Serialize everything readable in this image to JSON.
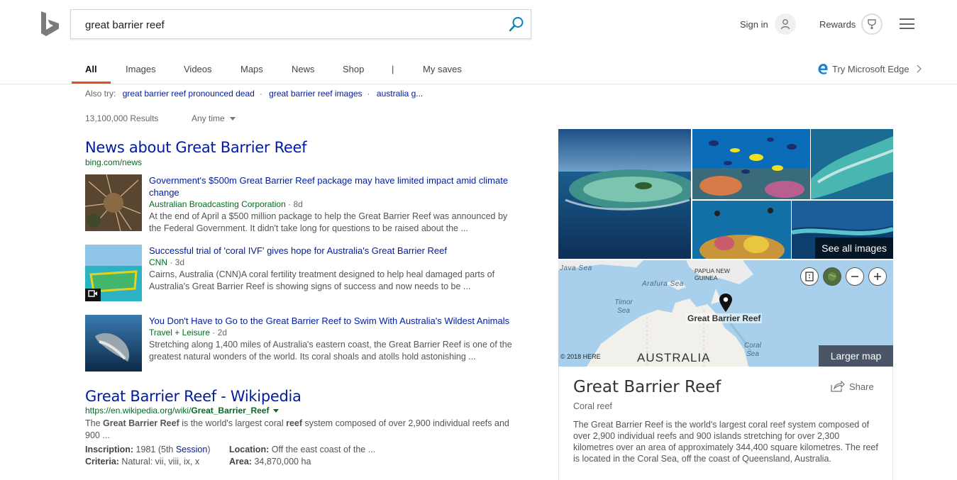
{
  "header": {
    "search_query": "great barrier reef",
    "sign_in_label": "Sign in",
    "rewards_label": "Rewards"
  },
  "tabs": [
    {
      "label": "All",
      "active": true
    },
    {
      "label": "Images"
    },
    {
      "label": "Videos"
    },
    {
      "label": "Maps"
    },
    {
      "label": "News"
    },
    {
      "label": "Shop"
    },
    {
      "label": "|"
    },
    {
      "label": "My saves"
    }
  ],
  "edge_promo": "Try Microsoft Edge",
  "also_try": {
    "label": "Also try:",
    "links": [
      "great barrier reef pronounced dead",
      "great barrier reef images",
      "australia g..."
    ]
  },
  "results_count": "13,100,000 Results",
  "time_filter": "Any time",
  "news": {
    "title": "News about Great Barrier Reef",
    "url": "bing.com/news",
    "items": [
      {
        "headline": "Government's $500m Great Barrier Reef package may have limited impact amid climate change",
        "source": "Australian Broadcasting Corporation",
        "age": "8d",
        "snippet": "At the end of April a $500 million package to help the Great Barrier Reef was announced by the Federal Government. It didn't take long for questions to be raised about the ..."
      },
      {
        "headline": "Successful trial of 'coral IVF' gives hope for Australia's Great Barrier Reef",
        "source": "CNN",
        "age": "3d",
        "snippet": "Cairns, Australia (CNN)A coral fertility treatment designed to help heal damaged parts of Australia's Great Barrier Reef is showing signs of success and now needs to be ..."
      },
      {
        "headline": "You Don't Have to Go to the Great Barrier Reef to Swim With Australia's Wildest Animals",
        "source": "Travel + Leisure",
        "age": "2d",
        "snippet": "Stretching along 1,400 miles of Australia's eastern coast, the Great Barrier Reef is one of the greatest natural wonders of the world. Its coral shoals and atolls hold astonishing ..."
      }
    ]
  },
  "wiki": {
    "title": "Great Barrier Reef - Wikipedia",
    "url_prefix": "https://en.wikipedia.org/wiki/",
    "url_bold": "Great_Barrier_Reef",
    "snippet_parts": [
      "The ",
      "Great Barrier Reef",
      " is the world's largest coral ",
      "reef",
      " system composed of over 2,900 individual reefs and 900 ..."
    ],
    "facts": [
      {
        "label": "Inscription:",
        "value": "1981 (5th ",
        "value_link": "Session",
        "value_end": ")"
      },
      {
        "label": "Location:",
        "value": "Off the east coast of the ..."
      },
      {
        "label": "Criteria:",
        "value": "Natural: vii, viii, ix, x"
      },
      {
        "label": "Area:",
        "value": "34,870,000 ha"
      }
    ]
  },
  "images_panel": {
    "see_all_label": "See all images"
  },
  "map": {
    "labels": {
      "java_sea": "Java Sea",
      "papua": "PAPUA NEW GUINEA",
      "arafura": "Arafura Sea",
      "timor": "Timor Sea",
      "pin": "Great Barrier Reef",
      "coral": "Coral Sea",
      "australia": "AUSTRALIA",
      "copyright": "© 2018 HERE"
    },
    "larger_map_label": "Larger map"
  },
  "entity": {
    "title": "Great Barrier Reef",
    "subtitle": "Coral reef",
    "share_label": "Share",
    "description": "The Great Barrier Reef is the world's largest coral reef system composed of over 2,900 individual reefs and 900 islands stretching for over 2,300 kilometres over an area of approximately 344,400 square kilometres. The reef is located in the Coral Sea, off the coast of Queensland, Australia."
  },
  "colors": {
    "link": "#001ba0",
    "url_green": "#006d21",
    "accent": "#e04e1e"
  }
}
